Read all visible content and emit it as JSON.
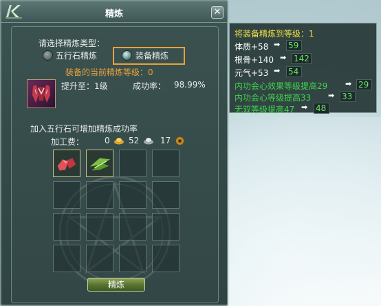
{
  "window": {
    "title": "精炼",
    "close_label": "✕"
  },
  "refine": {
    "select_type_label": "请选择精炼类型：",
    "option_stone": "五行石精炼",
    "option_equip": "装备精炼",
    "current_level_label": "装备的当前精炼等级：0",
    "upgrade_label": "提升至：1级",
    "success_label": "成功率：",
    "success_value": "98.99%",
    "hint": "加入五行石可增加精炼成功率",
    "fee_label": "加工费：",
    "fee_gold": "0",
    "fee_silver": "52",
    "fee_copper": "17",
    "refine_button": "精炼"
  },
  "tooltip": {
    "header": "将装备精炼到等级：1",
    "rows": [
      {
        "label": "体质+58",
        "value": "59",
        "kind": "white"
      },
      {
        "label": "根骨+140",
        "value": "142",
        "kind": "white"
      },
      {
        "label": "元气+53",
        "value": "54",
        "kind": "white"
      },
      {
        "label": "内功会心效果等级提高29",
        "value": "29",
        "kind": "green"
      },
      {
        "label": "内功会心等级提高33",
        "value": "33",
        "kind": "green"
      },
      {
        "label": "无双等级提高47",
        "value": "48",
        "kind": "green"
      }
    ]
  },
  "colors": {
    "highlight": "#e9a23a",
    "green_stat": "#3fd24a",
    "header_yellow": "#f2e04a"
  }
}
